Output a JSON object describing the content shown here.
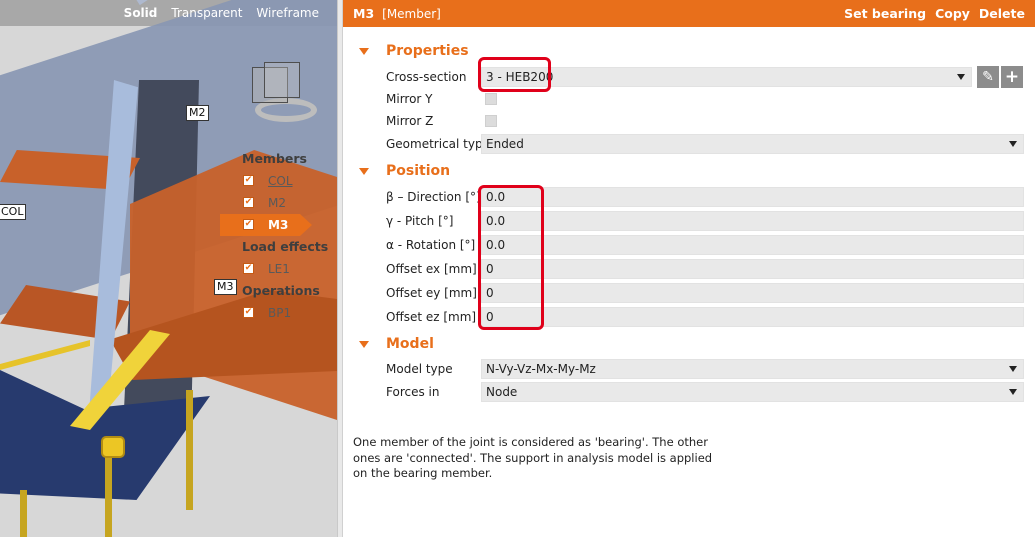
{
  "viewport": {
    "modes": [
      "Solid",
      "Transparent",
      "Wireframe"
    ],
    "active_mode": "Solid",
    "labels": {
      "m2": "M2",
      "col": "COL",
      "m3": "M3"
    },
    "tree": {
      "members_label": "Members",
      "members": [
        "COL",
        "M2",
        "M3"
      ],
      "load_effects_label": "Load effects",
      "load_effects": [
        "LE1"
      ],
      "operations_label": "Operations",
      "operations": [
        "BP1"
      ]
    }
  },
  "panel": {
    "title": "M3",
    "kind": "[Member]",
    "actions": [
      "Set bearing",
      "Copy",
      "Delete"
    ],
    "properties": {
      "section_title": "Properties",
      "cross_section_label": "Cross-section",
      "cross_section_value": "3 - HEB200",
      "mirror_y_label": "Mirror Y",
      "mirror_z_label": "Mirror Z",
      "geometrical_type_label": "Geometrical type",
      "geometrical_type_value": "Ended"
    },
    "position": {
      "section_title": "Position",
      "rows": [
        {
          "label": "β – Direction [°]",
          "value": "0.0"
        },
        {
          "label": "γ - Pitch [°]",
          "value": "0.0"
        },
        {
          "label": "α - Rotation [°]",
          "value": "0.0"
        },
        {
          "label": "Offset ex [mm]",
          "value": "0"
        },
        {
          "label": "Offset ey [mm]",
          "value": "0"
        },
        {
          "label": "Offset ez [mm]",
          "value": "0"
        }
      ]
    },
    "model": {
      "section_title": "Model",
      "model_type_label": "Model type",
      "model_type_value": "N-Vy-Vz-Mx-My-Mz",
      "forces_in_label": "Forces in",
      "forces_in_value": "Node"
    },
    "description": "One member of the joint is considered as 'bearing'. The other ones are 'connected'. The support in analysis model is applied on the bearing member."
  },
  "colors": {
    "accent": "#e86f1b",
    "highlight": "#e0001a",
    "field_bg": "#e9e9e9"
  },
  "icons": {
    "edit": "pencil-icon",
    "add": "plus-icon"
  }
}
